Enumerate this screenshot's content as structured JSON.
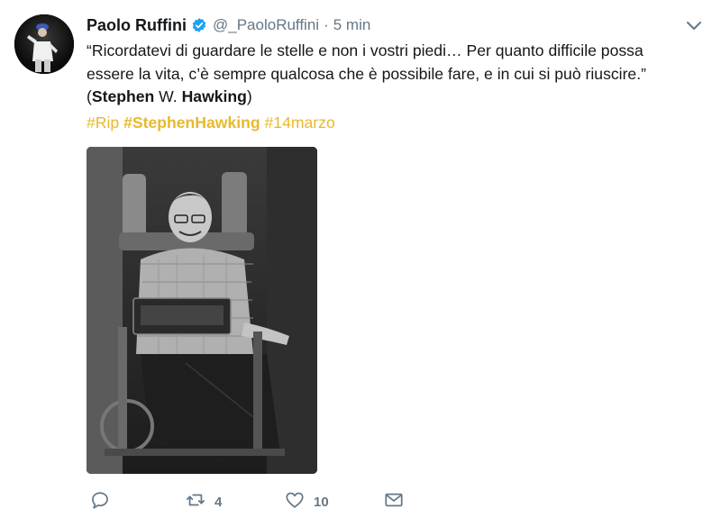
{
  "tweet": {
    "author_name": "Paolo Ruffini",
    "handle": "@_PaoloRuffini",
    "separator": "·",
    "time": "5 min",
    "text_line1": "“Ricordatevi di guardare le stelle e non i vostri piedi… Per quanto difficile possa",
    "text_line2": "essere la vita, c’è sempre qualcosa che è possibile fare, e in cui si può riuscire.”",
    "quote_open": "(",
    "quote_name1": "Stephen",
    "quote_middle": " W. ",
    "quote_name2": "Hawking",
    "quote_close": ")",
    "hashtags": [
      {
        "text": "#Rip",
        "bold": false
      },
      {
        "text": "#StephenHawking",
        "bold": true
      },
      {
        "text": "#14marzo",
        "bold": false
      }
    ],
    "actions": {
      "reply_count": "",
      "retweet_count": "4",
      "like_count": "10"
    }
  },
  "colors": {
    "hashtag": "#e8b92c",
    "verified": "#1da1f2",
    "muted": "#657786",
    "text": "#14171a"
  },
  "icons": {
    "verified": "verified-badge-icon",
    "caret": "chevron-down-icon",
    "reply": "reply-icon",
    "retweet": "retweet-icon",
    "like": "heart-icon",
    "dm": "envelope-icon"
  }
}
